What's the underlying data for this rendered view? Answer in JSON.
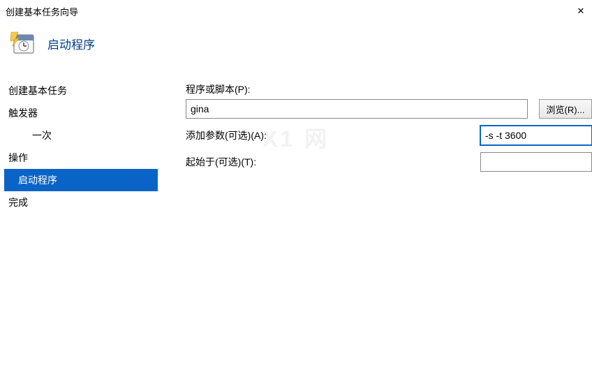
{
  "window": {
    "title": "创建基本任务向导",
    "close": "✕"
  },
  "header": {
    "title": "启动程序"
  },
  "sidebar": {
    "items": [
      {
        "label": "创建基本任务",
        "type": "group"
      },
      {
        "label": "触发器",
        "type": "group"
      },
      {
        "label": "一次",
        "type": "sub"
      },
      {
        "label": "操作",
        "type": "group"
      },
      {
        "label": "启动程序",
        "type": "sub",
        "selected": true
      },
      {
        "label": "完成",
        "type": "group"
      }
    ]
  },
  "form": {
    "program_label": "程序或脚本(P):",
    "program_value": "gina",
    "browse": "浏览(R)...",
    "args_label": "添加参数(可选)(A):",
    "args_value": "-s -t 3600",
    "startin_label": "起始于(可选)(T):",
    "startin_value": ""
  },
  "watermark": "X1 网"
}
